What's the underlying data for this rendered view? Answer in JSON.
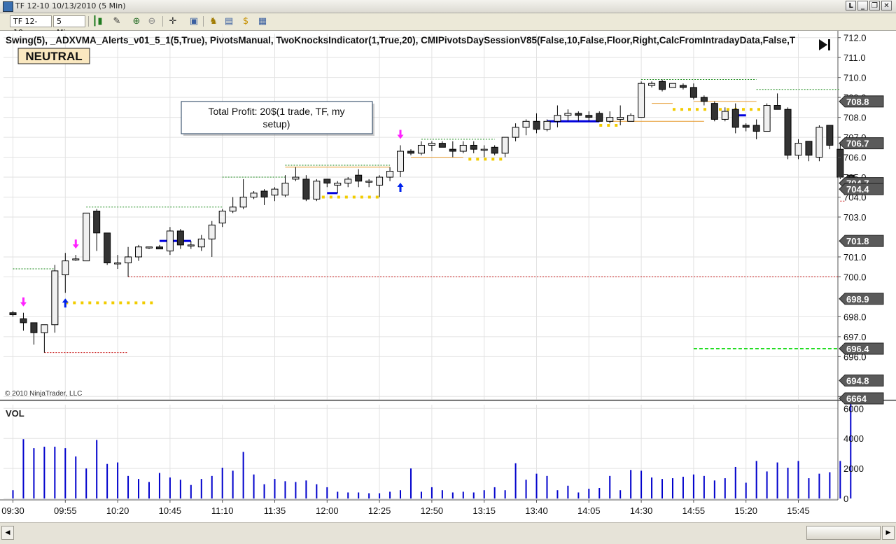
{
  "window": {
    "title": "TF 12-10  10/13/2010 (5 Min)",
    "buttons": [
      "L",
      "_",
      "❐",
      "✕"
    ]
  },
  "toolbar": {
    "instrument": "TF 12-10",
    "interval": "5 Min",
    "icons": [
      "bar-chart-icon",
      "pencil-icon",
      "zoom-in-icon",
      "zoom-out-icon",
      "crosshair-icon",
      "properties-icon",
      "strategy-icon",
      "chart-trader-icon",
      "dollar-icon",
      "data-box-icon"
    ]
  },
  "chart_data": {
    "type": "candlestick",
    "indicator_line": "Swing(5),  _ADXVMA_Alerts_v01_5_1(5,True),  PivotsManual,  TwoKnocksIndicator(1,True,20),  CMIPivotsDaySessionV85(False,10,False,Floor,Right,CalcFromIntradayData,False,T",
    "state_badge": "NEUTRAL",
    "copyright": "© 2010 NinjaTrader, LLC",
    "annotation": "Total Profit: 20$(1 trade, TF, my setup)",
    "vol_label": "VOL",
    "price_ylim": [
      693.8,
      712.2
    ],
    "price_ticks": [
      "694.0",
      "696.0",
      "697.0",
      "698.0",
      "700.0",
      "701.0",
      "703.0",
      "704.0",
      "705.0",
      "706.0",
      "707.0",
      "708.0",
      "709.0",
      "710.0",
      "711.0",
      "712.0"
    ],
    "price_tick_values": [
      694,
      696,
      697,
      698,
      700,
      701,
      703,
      704,
      705,
      706,
      707,
      708,
      709,
      710,
      711,
      712
    ],
    "price_markers": [
      {
        "label": "708.8",
        "value": 708.8
      },
      {
        "label": "706.7",
        "value": 706.7
      },
      {
        "label": "704.7",
        "value": 704.7
      },
      {
        "label": "704.4",
        "value": 704.4
      },
      {
        "label": "701.8",
        "value": 701.8
      },
      {
        "label": "698.9",
        "value": 698.9
      },
      {
        "label": "696.4",
        "value": 696.4
      },
      {
        "label": "694.8",
        "value": 694.8
      }
    ],
    "vol_ticks": [
      "0",
      "2000",
      "4000",
      "6000"
    ],
    "vol_tick_values": [
      0,
      2000,
      4000,
      6000
    ],
    "vol_ylim": [
      0,
      6900
    ],
    "vol_marker": {
      "label": "6664",
      "value": 6664
    },
    "x_tick_labels": [
      "09:30",
      "09:55",
      "10:20",
      "10:45",
      "11:10",
      "11:35",
      "12:00",
      "12:25",
      "12:50",
      "13:15",
      "13:40",
      "14:05",
      "14:30",
      "14:55",
      "15:20",
      "15:45"
    ],
    "x_tick_bar_index": [
      0,
      5,
      10,
      15,
      20,
      25,
      30,
      35,
      40,
      45,
      50,
      55,
      60,
      65,
      70,
      75
    ],
    "ohlc": [
      [
        698.2,
        698.3,
        698.0,
        698.1
      ],
      [
        697.9,
        698.2,
        697.3,
        697.7
      ],
      [
        697.7,
        697.7,
        696.6,
        697.2
      ],
      [
        697.2,
        697.6,
        696.2,
        697.6
      ],
      [
        697.6,
        700.6,
        697.2,
        700.3
      ],
      [
        700.1,
        701.2,
        699.2,
        700.8
      ],
      [
        700.9,
        701.1,
        700.8,
        700.9
      ],
      [
        700.8,
        703.2,
        700.8,
        703.2
      ],
      [
        703.3,
        703.4,
        701.3,
        702.2
      ],
      [
        702.2,
        702.2,
        700.6,
        700.7
      ],
      [
        700.7,
        701.1,
        700.4,
        700.7
      ],
      [
        700.7,
        701.5,
        700.0,
        701.0
      ],
      [
        701.0,
        701.6,
        700.8,
        701.5
      ],
      [
        701.5,
        701.5,
        701.4,
        701.5
      ],
      [
        701.5,
        701.6,
        701.4,
        701.4
      ],
      [
        701.3,
        702.5,
        701.1,
        702.3
      ],
      [
        702.3,
        702.4,
        701.4,
        701.6
      ],
      [
        701.6,
        701.8,
        701.4,
        701.6
      ],
      [
        701.5,
        702.1,
        701.3,
        701.9
      ],
      [
        701.9,
        702.8,
        701.0,
        702.6
      ],
      [
        702.7,
        703.4,
        702.5,
        703.3
      ],
      [
        703.3,
        704.0,
        703.2,
        703.5
      ],
      [
        703.5,
        704.9,
        703.4,
        704.0
      ],
      [
        704.0,
        704.3,
        703.9,
        704.2
      ],
      [
        704.3,
        704.4,
        703.6,
        704.0
      ],
      [
        704.1,
        704.5,
        703.8,
        704.4
      ],
      [
        704.1,
        705.1,
        704.0,
        704.7
      ],
      [
        704.9,
        705.5,
        704.8,
        705.0
      ],
      [
        704.9,
        705.1,
        703.8,
        703.9
      ],
      [
        703.9,
        704.9,
        703.8,
        704.8
      ],
      [
        704.9,
        704.9,
        704.5,
        704.7
      ],
      [
        704.6,
        704.8,
        704.2,
        704.7
      ],
      [
        704.7,
        705.0,
        704.5,
        704.9
      ],
      [
        705.1,
        705.4,
        704.5,
        704.8
      ],
      [
        704.8,
        704.9,
        704.5,
        704.8
      ],
      [
        704.6,
        705.1,
        704.0,
        705.0
      ],
      [
        705.0,
        705.5,
        704.8,
        705.3
      ],
      [
        705.3,
        706.6,
        705.0,
        706.3
      ],
      [
        706.3,
        706.4,
        706.1,
        706.2
      ],
      [
        706.2,
        706.8,
        706.1,
        706.6
      ],
      [
        706.6,
        706.8,
        706.3,
        706.7
      ],
      [
        706.7,
        706.8,
        706.5,
        706.5
      ],
      [
        706.4,
        706.8,
        706.0,
        706.3
      ],
      [
        706.3,
        706.8,
        706.2,
        706.6
      ],
      [
        706.6,
        706.8,
        706.2,
        706.4
      ],
      [
        706.4,
        706.6,
        706.0,
        706.4
      ],
      [
        706.5,
        706.6,
        706.1,
        706.2
      ],
      [
        706.2,
        707.0,
        706.0,
        707.0
      ],
      [
        707.0,
        707.7,
        706.8,
        707.5
      ],
      [
        707.5,
        707.9,
        707.1,
        707.8
      ],
      [
        707.8,
        708.2,
        707.2,
        707.4
      ],
      [
        707.4,
        707.9,
        707.3,
        707.8
      ],
      [
        707.8,
        708.6,
        707.5,
        708.1
      ],
      [
        708.1,
        708.4,
        707.8,
        708.2
      ],
      [
        708.2,
        708.3,
        707.8,
        708.1
      ],
      [
        708.1,
        708.3,
        707.8,
        708.0
      ],
      [
        708.2,
        708.3,
        707.8,
        707.8
      ],
      [
        707.8,
        708.3,
        707.7,
        708.0
      ],
      [
        707.9,
        708.6,
        707.6,
        708.0
      ],
      [
        707.8,
        708.2,
        707.8,
        708.1
      ],
      [
        708.0,
        709.8,
        708.0,
        709.7
      ],
      [
        709.6,
        709.8,
        709.5,
        709.7
      ],
      [
        709.8,
        709.9,
        709.3,
        709.4
      ],
      [
        709.5,
        709.7,
        709.5,
        709.7
      ],
      [
        709.6,
        709.7,
        709.4,
        709.5
      ],
      [
        709.5,
        709.7,
        708.9,
        709.0
      ],
      [
        709.0,
        709.1,
        708.6,
        708.8
      ],
      [
        708.7,
        708.8,
        707.8,
        707.9
      ],
      [
        707.9,
        708.5,
        707.8,
        708.3
      ],
      [
        708.4,
        708.7,
        707.2,
        707.5
      ],
      [
        707.6,
        707.7,
        707.3,
        707.5
      ],
      [
        707.6,
        707.9,
        706.9,
        707.3
      ],
      [
        707.3,
        708.7,
        707.3,
        708.6
      ],
      [
        708.6,
        709.2,
        708.5,
        708.4
      ],
      [
        708.4,
        708.5,
        705.9,
        706.1
      ],
      [
        706.1,
        706.9,
        705.9,
        706.7
      ],
      [
        706.8,
        706.8,
        705.8,
        706.1
      ],
      [
        706.0,
        707.6,
        705.8,
        707.5
      ],
      [
        707.6,
        707.6,
        706.4,
        706.6
      ],
      [
        706.4,
        706.7,
        704.9,
        705.0
      ],
      [
        705.1,
        705.1,
        704.1,
        704.4
      ]
    ],
    "volume": [
      550,
      3950,
      3350,
      3450,
      3450,
      3350,
      2800,
      2000,
      3900,
      2300,
      2400,
      1500,
      1300,
      1100,
      1700,
      1400,
      1250,
      900,
      1300,
      1500,
      2050,
      1850,
      3100,
      1600,
      950,
      1300,
      1150,
      1100,
      1200,
      950,
      750,
      450,
      400,
      400,
      350,
      350,
      450,
      550,
      2000,
      450,
      750,
      550,
      400,
      450,
      400,
      550,
      750,
      550,
      2350,
      1250,
      1650,
      1500,
      550,
      850,
      400,
      650,
      700,
      1500,
      550,
      1900,
      1850,
      1400,
      1300,
      1350,
      1450,
      1600,
      1500,
      1200,
      1350,
      2100,
      1050,
      2500,
      1800,
      2400,
      2050,
      2500,
      1350,
      1650,
      1750,
      2500,
      6664
    ],
    "swing_highs": [
      {
        "value": 700.4,
        "from": 0,
        "to": 4
      },
      {
        "value": 703.5,
        "from": 7,
        "to": 20
      },
      {
        "value": 705.0,
        "from": 20,
        "to": 26
      },
      {
        "value": 705.6,
        "from": 26,
        "to": 36
      },
      {
        "value": 706.9,
        "from": 39,
        "to": 46
      },
      {
        "value": 709.9,
        "from": 60,
        "to": 71
      },
      {
        "value": 709.4,
        "from": 71,
        "to": 79
      }
    ],
    "swing_lows": [
      {
        "value": 696.2,
        "from": 3,
        "to": 11
      },
      {
        "value": 700.0,
        "from": 11,
        "to": 79
      },
      {
        "value": 703.8,
        "from": 79,
        "to": 79.5
      }
    ],
    "pivot_line": {
      "value": 696.4,
      "from": 65,
      "to": 79.2
    },
    "yellow_dots": [
      {
        "value": 698.7,
        "from": 5,
        "to": 13.5
      },
      {
        "value": 704.0,
        "from": 29.5,
        "to": 35
      },
      {
        "value": 705.9,
        "from": 43.5,
        "to": 47
      },
      {
        "value": 707.6,
        "from": 56,
        "to": 58
      },
      {
        "value": 708.4,
        "from": 63,
        "to": 72
      }
    ],
    "orange_levels": [
      {
        "value": 705.5,
        "from": 26,
        "to": 36
      },
      {
        "value": 706.0,
        "from": 38,
        "to": 43
      },
      {
        "value": 707.8,
        "from": 57,
        "to": 66
      },
      {
        "value": 708.7,
        "from": 61,
        "to": 63
      },
      {
        "value": 708.8,
        "from": 65,
        "to": 71
      }
    ],
    "blue_segments": [
      {
        "value": 701.8,
        "from": 14,
        "to": 17
      },
      {
        "value": 704.2,
        "from": 30,
        "to": 31
      },
      {
        "value": 707.8,
        "from": 51,
        "to": 56
      },
      {
        "value": 708.1,
        "from": 69,
        "to": 70
      }
    ],
    "sell_arrows": [
      1,
      6,
      37
    ],
    "buy_arrows": [
      5,
      37
    ]
  }
}
